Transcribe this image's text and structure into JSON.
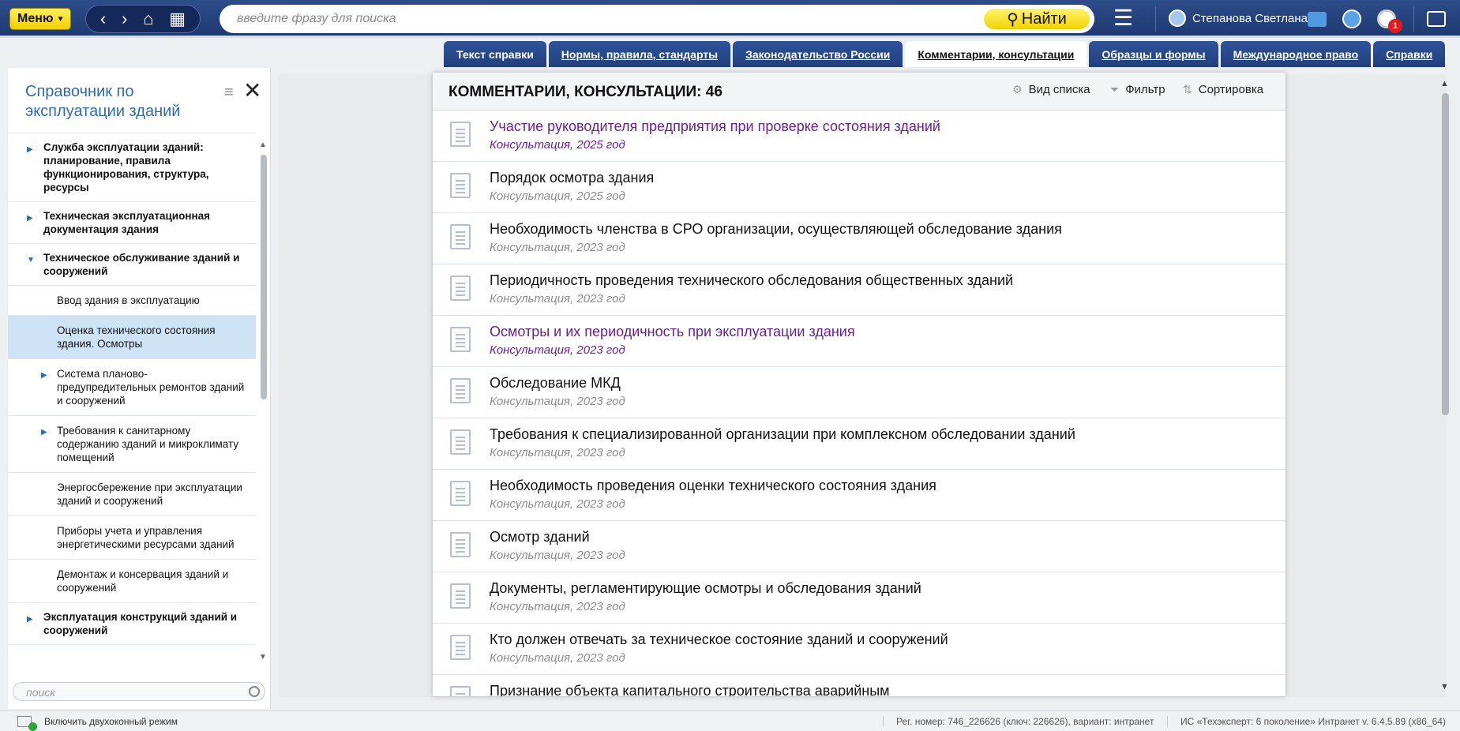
{
  "topbar": {
    "menu_label": "Меню",
    "search_placeholder": "введите фразу для поиска",
    "find_label": "Найти",
    "user_name": "Степанова Светлана",
    "notification_count": "1"
  },
  "tabs": [
    {
      "label": "Текст справки"
    },
    {
      "label": "Нормы, правила, стандарты"
    },
    {
      "label": "Законодательство России"
    },
    {
      "label": "Комментарии, консультации"
    },
    {
      "label": "Образцы и формы"
    },
    {
      "label": "Международное право"
    },
    {
      "label": "Справки"
    }
  ],
  "left_panel": {
    "title": "Справочник по эксплуатации зданий",
    "search_placeholder": "поиск",
    "items": [
      {
        "label": "Служба эксплуатации зданий: планирование, правила функционирования, структура, ресурсы"
      },
      {
        "label": "Техническая эксплуатационная документация здания"
      },
      {
        "label": "Техническое обслуживание зданий и сооружений"
      },
      {
        "label": "Ввод здания в эксплуатацию"
      },
      {
        "label": "Оценка технического состояния здания. Осмотры"
      },
      {
        "label": "Система планово-предупредительных ремонтов зданий и сооружений"
      },
      {
        "label": "Требования к санитарному содержанию зданий и микроклимату помещений"
      },
      {
        "label": "Энергосбережение при эксплуатации зданий и сооружений"
      },
      {
        "label": "Приборы учета и управления энергетическими ресурсами зданий"
      },
      {
        "label": "Демонтаж и консервация зданий и сооружений"
      },
      {
        "label": "Эксплуатация конструкций зданий и сооружений"
      }
    ]
  },
  "doclist": {
    "title": "КОММЕНТАРИИ, КОНСУЛЬТАЦИИ: 46",
    "tool_view": "Вид списка",
    "tool_filter": "Фильтр",
    "tool_sort": "Сортировка",
    "rows": [
      {
        "name": "Участие руководителя предприятия при проверке состояния зданий",
        "sub": "Консультация, 2025 год"
      },
      {
        "name": "Порядок осмотра здания",
        "sub": "Консультация, 2025 год"
      },
      {
        "name": "Необходимость членства в СРО организации, осуществляющей обследование здания",
        "sub": "Консультация, 2023 год"
      },
      {
        "name": "Периодичность проведения технического обследования общественных зданий",
        "sub": "Консультация, 2023 год"
      },
      {
        "name": "Осмотры и их периодичность при эксплуатации здания",
        "sub": "Консультация, 2023 год"
      },
      {
        "name": "Обследование МКД",
        "sub": "Консультация, 2023 год"
      },
      {
        "name": "Требования к специализированной организации при комплексном обследовании зданий",
        "sub": "Консультация, 2023 год"
      },
      {
        "name": "Необходимость проведения оценки технического состояния здания",
        "sub": "Консультация, 2023 год"
      },
      {
        "name": "Осмотр зданий",
        "sub": "Консультация, 2023 год"
      },
      {
        "name": "Документы, регламентирующие осмотры и обследования зданий",
        "sub": "Консультация, 2023 год"
      },
      {
        "name": "Кто должен отвечать за техническое состояние зданий и сооружений",
        "sub": "Консультация, 2023 год"
      },
      {
        "name": "Признание объекта капитального строительства аварийным",
        "sub": ""
      }
    ]
  },
  "status": {
    "dual_mode": "Включить двухоконный режим",
    "reg": "Рег. номер: 746_226626 (ключ: 226626), вариант: интранет",
    "version": "ИС «Техэксперт: 6 поколение» Интранет v. 6.4.5.89 (x86_64)"
  }
}
